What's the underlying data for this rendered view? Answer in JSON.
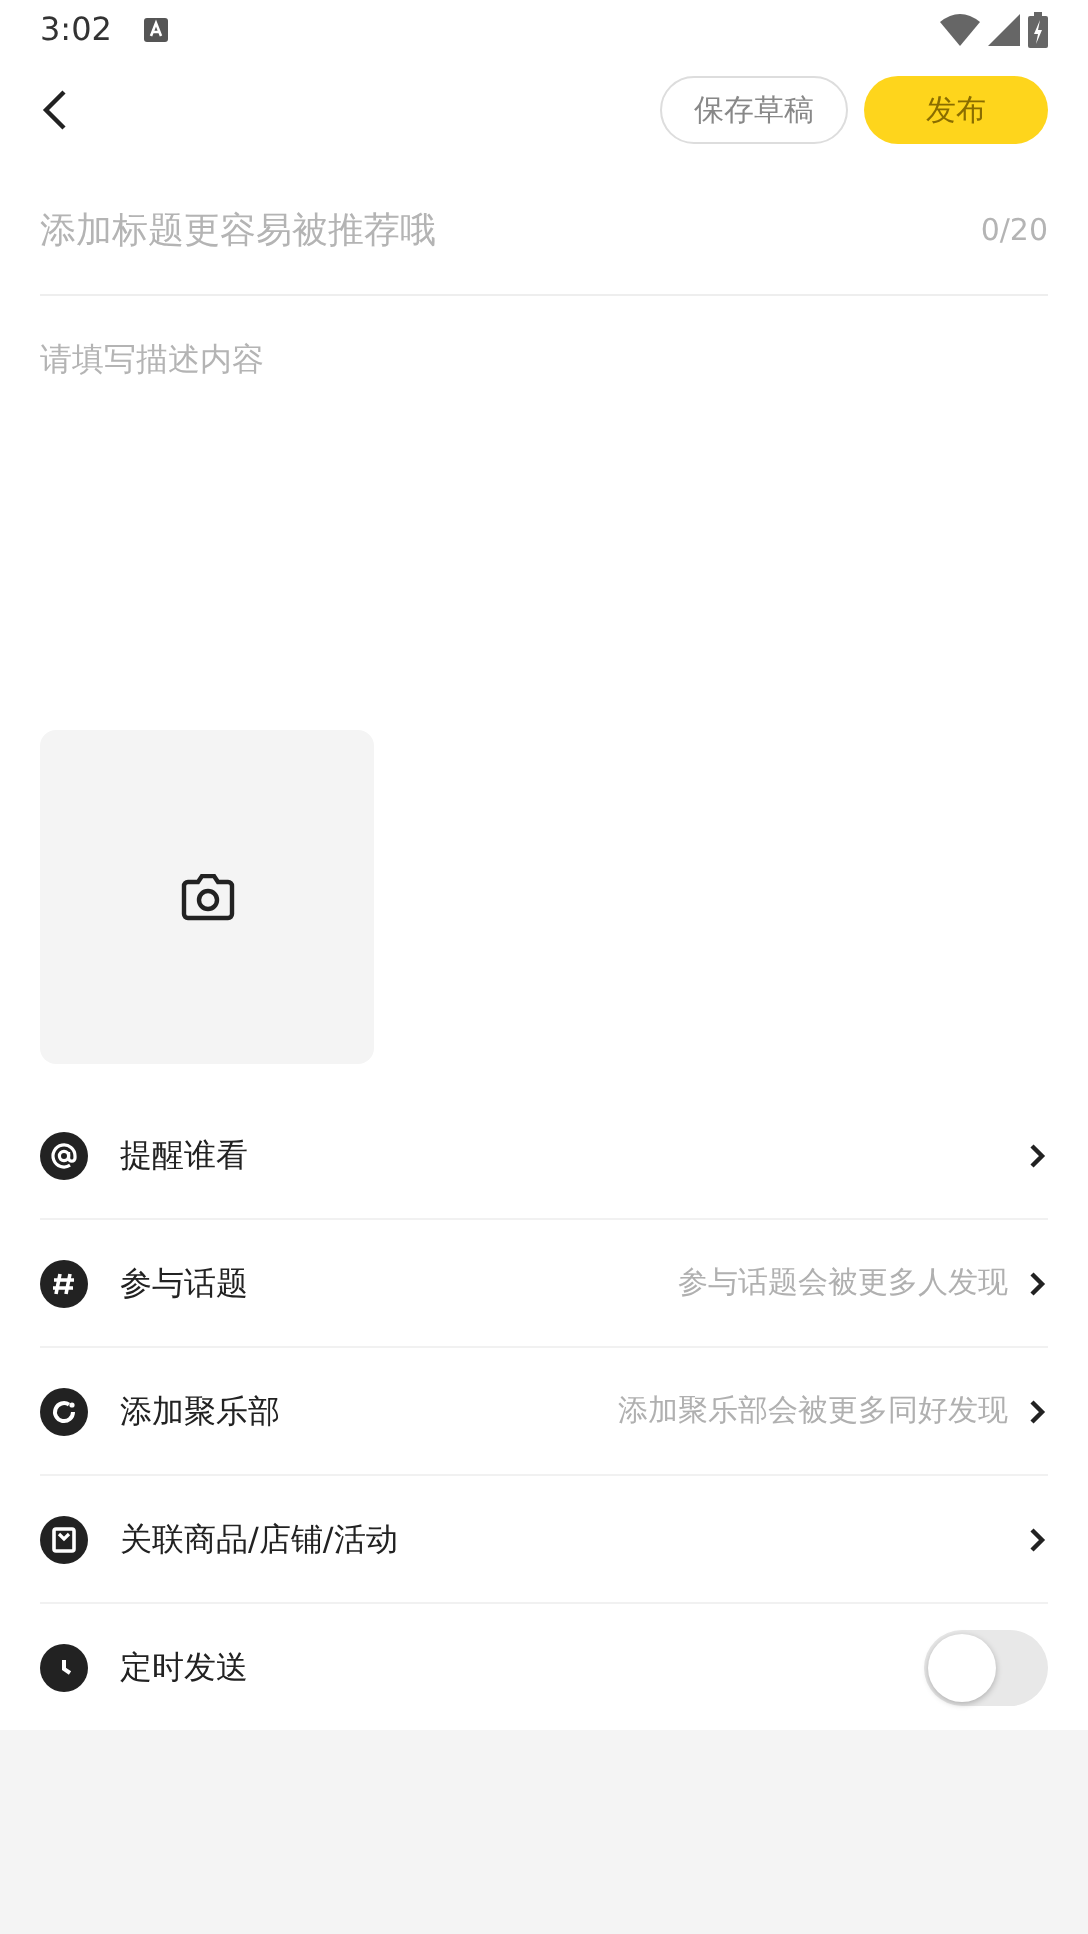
{
  "status_bar": {
    "time": "3:02"
  },
  "header": {
    "save_draft": "保存草稿",
    "publish": "发布"
  },
  "title_field": {
    "placeholder": "添加标题更容易被推荐哦",
    "counter": "0/20"
  },
  "description_field": {
    "placeholder": "请填写描述内容"
  },
  "options": [
    {
      "kind": "link",
      "label": "提醒谁看"
    },
    {
      "kind": "link",
      "label": "参与话题",
      "hint": "参与话题会被更多人发现"
    },
    {
      "kind": "link",
      "label": "添加聚乐部",
      "hint": "添加聚乐部会被更多同好发现"
    },
    {
      "kind": "link",
      "label": "关联商品/店铺/活动"
    },
    {
      "kind": "toggle",
      "label": "定时发送",
      "on": false
    }
  ]
}
